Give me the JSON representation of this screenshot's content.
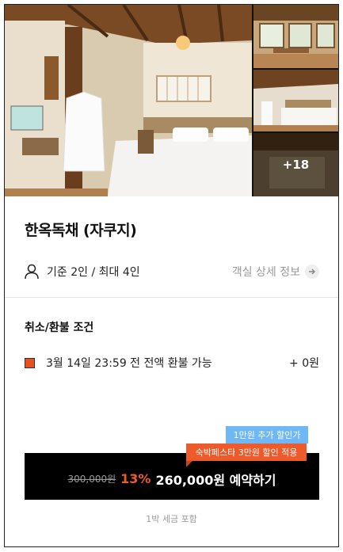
{
  "gallery": {
    "more_count": "+18"
  },
  "room": {
    "title": "한옥독채 (자쿠지)",
    "capacity": "기준 2인 / 최대 4인",
    "detail_link": "객실 상세 정보"
  },
  "cancellation": {
    "title": "취소/환불 조건",
    "policy_text": "3월 14일 23:59 전 전액 환불 가능",
    "policy_amount": "+ 0원"
  },
  "booking": {
    "badge_extra": "1만원 추가 할인가",
    "badge_festa": "숙박페스타 3만원 할인 적용",
    "original_price": "300,000원",
    "discount_rate": "13%",
    "action_label": "260,000원 예약하기",
    "tax_note": "1박 세금 포함"
  },
  "colors": {
    "accent": "#ef5a2a",
    "badge_blue": "#6fb7f5",
    "button_bg": "#000000"
  }
}
